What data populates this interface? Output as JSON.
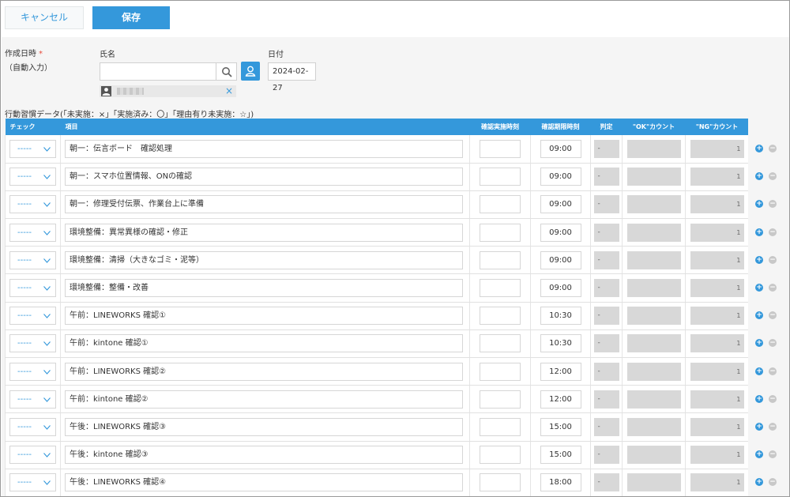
{
  "toolbar": {
    "cancel_label": "キャンセル",
    "save_label": "保存"
  },
  "form": {
    "created_label": "作成日時",
    "required_mark": "*",
    "auto_label": "（自動入力）",
    "name_label": "氏名",
    "date_label": "日付",
    "date_value": "2024-02-27"
  },
  "section_label": "行動習慣データ(「未実施：×」「実施済み：〇」「理由有り未実施：☆」)",
  "table": {
    "headers": [
      "チェック",
      "項目",
      "確認実施時刻",
      "確認期限時刻",
      "判定",
      "\"OK\"カウント",
      "\"NG\"カウント"
    ],
    "rows": [
      {
        "check": "-----",
        "item": "朝一：伝言ボード　確認処理",
        "deadline": "09:00",
        "judge": "-",
        "ng": "1"
      },
      {
        "check": "-----",
        "item": "朝一：スマホ位置情報、ONの確認",
        "deadline": "09:00",
        "judge": "-",
        "ng": "1"
      },
      {
        "check": "-----",
        "item": "朝一：修理受付伝票、作業台上に準備",
        "deadline": "09:00",
        "judge": "-",
        "ng": "1"
      },
      {
        "check": "-----",
        "item": "環境整備：異常異様の確認・修正",
        "deadline": "09:00",
        "judge": "-",
        "ng": "1"
      },
      {
        "check": "-----",
        "item": "環境整備：清掃（大きなゴミ・泥等）",
        "deadline": "09:00",
        "judge": "-",
        "ng": "1"
      },
      {
        "check": "-----",
        "item": "環境整備：整備・改善",
        "deadline": "09:00",
        "judge": "-",
        "ng": "1"
      },
      {
        "check": "-----",
        "item": "午前：LINEWORKS 確認①",
        "deadline": "10:30",
        "judge": "-",
        "ng": "1"
      },
      {
        "check": "-----",
        "item": "午前：kintone 確認①",
        "deadline": "10:30",
        "judge": "-",
        "ng": "1"
      },
      {
        "check": "-----",
        "item": "午前：LINEWORKS 確認②",
        "deadline": "12:00",
        "judge": "-",
        "ng": "1"
      },
      {
        "check": "-----",
        "item": "午前：kintone 確認②",
        "deadline": "12:00",
        "judge": "-",
        "ng": "1"
      },
      {
        "check": "-----",
        "item": "午後：LINEWORKS 確認③",
        "deadline": "15:00",
        "judge": "-",
        "ng": "1"
      },
      {
        "check": "-----",
        "item": "午後：kintone 確認③",
        "deadline": "15:00",
        "judge": "-",
        "ng": "1"
      },
      {
        "check": "-----",
        "item": "午後：LINEWORKS 確認④",
        "deadline": "18:00",
        "judge": "-",
        "ng": "1"
      }
    ]
  },
  "icons": {
    "search": "search-icon",
    "user": "user-icon",
    "avatar": "avatar-icon",
    "remove": "close-icon",
    "dropdown": "chevron-down-icon",
    "add": "plus-icon",
    "delete": "minus-icon"
  },
  "colors": {
    "accent": "#3498db",
    "required": "#e74c3c"
  },
  "controls": {
    "add_symbol": "+",
    "remove_symbol": "−",
    "chip_remove": "×"
  }
}
